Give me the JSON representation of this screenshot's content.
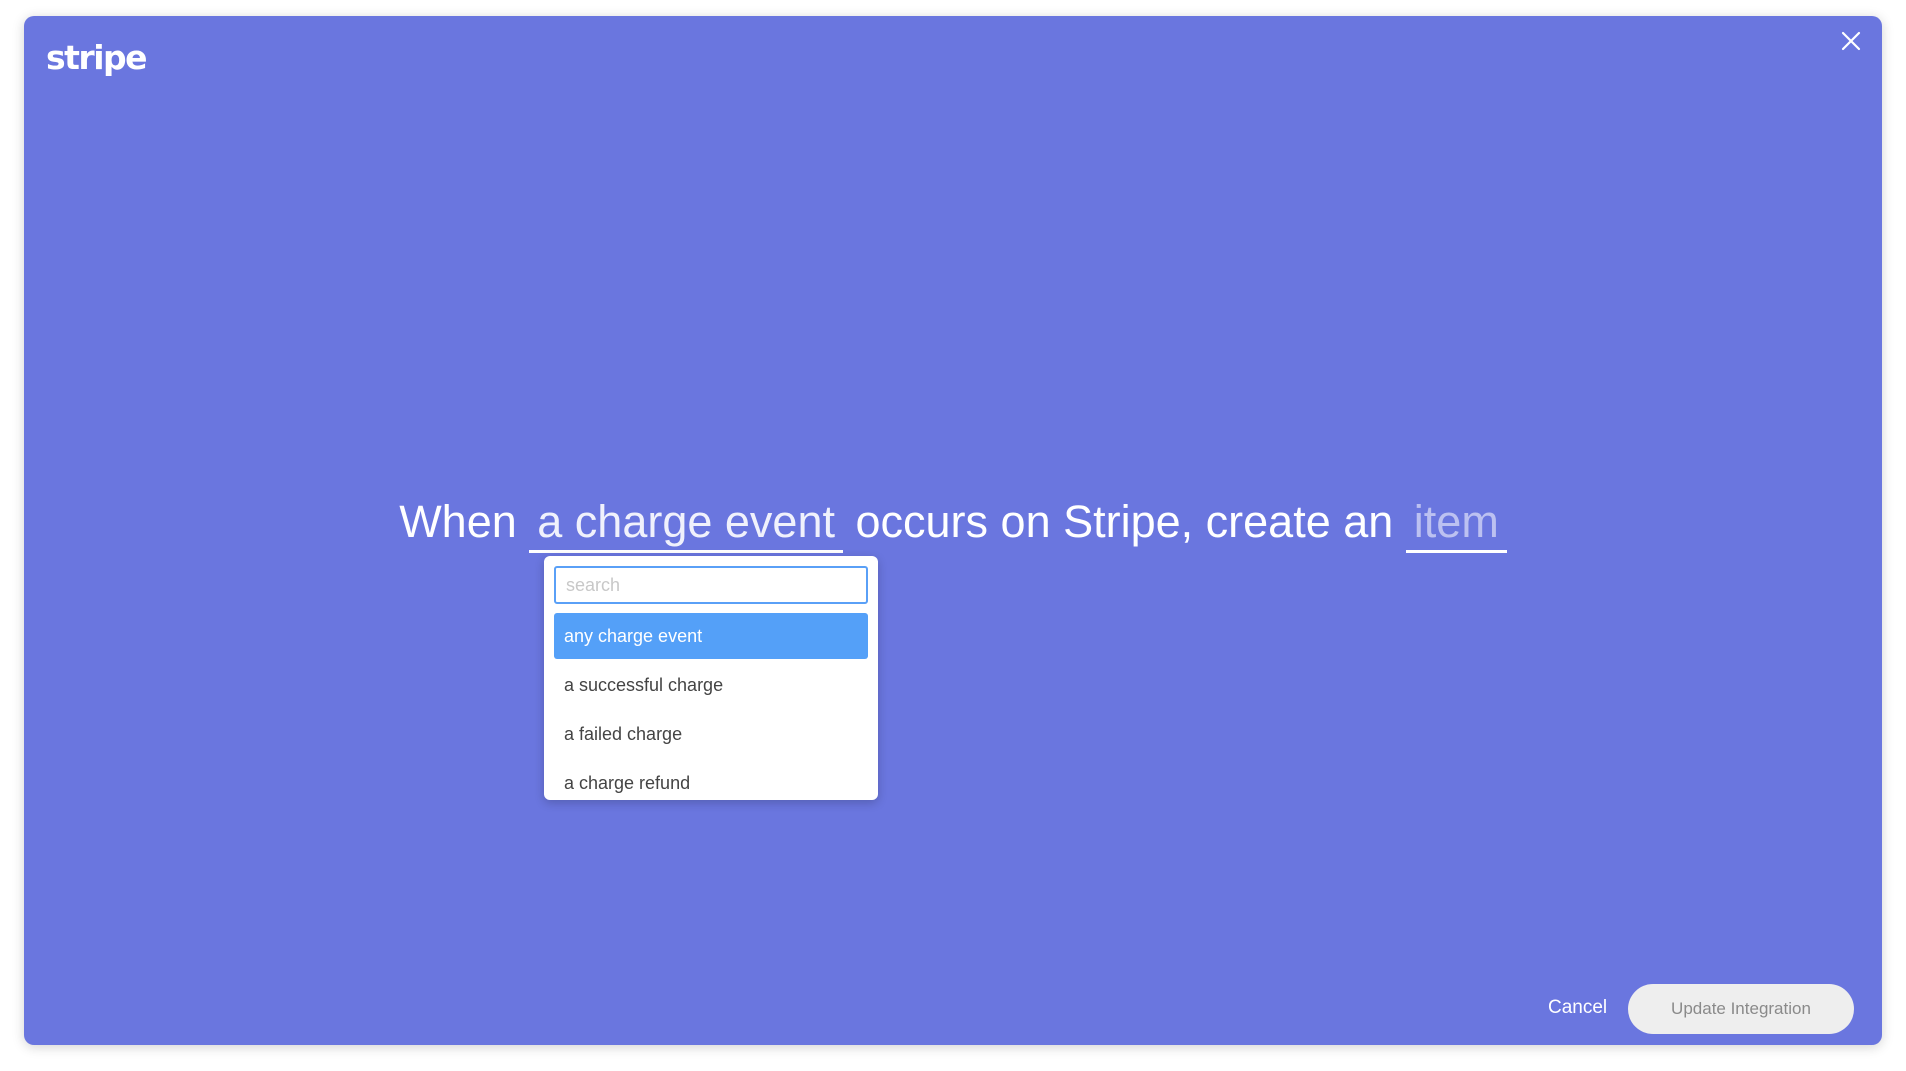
{
  "colors": {
    "background": "#6a76df",
    "accent": "#54a0f8",
    "button_bg": "#eeeeee"
  },
  "brand": {
    "logo_text": "stripe"
  },
  "close": {
    "icon": "close-icon"
  },
  "sentence": {
    "part1": "When",
    "event_slot": "a charge event",
    "part2": "occurs on Stripe, create an",
    "item_slot": "item"
  },
  "dropdown": {
    "search_placeholder": "search",
    "search_value": "",
    "options": [
      {
        "label": "any charge event",
        "selected": true
      },
      {
        "label": "a successful charge",
        "selected": false
      },
      {
        "label": "a failed charge",
        "selected": false
      },
      {
        "label": "a charge refund",
        "selected": false
      }
    ]
  },
  "footer": {
    "cancel_label": "Cancel",
    "update_label": "Update Integration"
  }
}
